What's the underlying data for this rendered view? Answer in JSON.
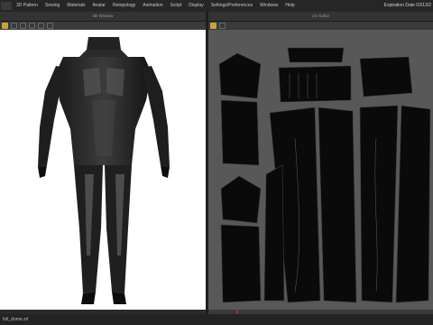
{
  "menu": [
    "3D Pattern",
    "Sewing",
    "Materials",
    "Avatar",
    "Retopology",
    "Animation",
    "Script",
    "Display",
    "Settings/Preferences",
    "Windows",
    "Help"
  ],
  "expiry": "Expiration Date 03/13/2",
  "panels": {
    "left_title": "3D Window",
    "right_title": "UV Editor"
  },
  "status": {
    "file": "full_dome.zrl"
  },
  "colors": {
    "background3d": "#ffffff",
    "uvBackground": "#585858",
    "pattern": "#0a0a0a",
    "accent": "#c9a23a"
  }
}
